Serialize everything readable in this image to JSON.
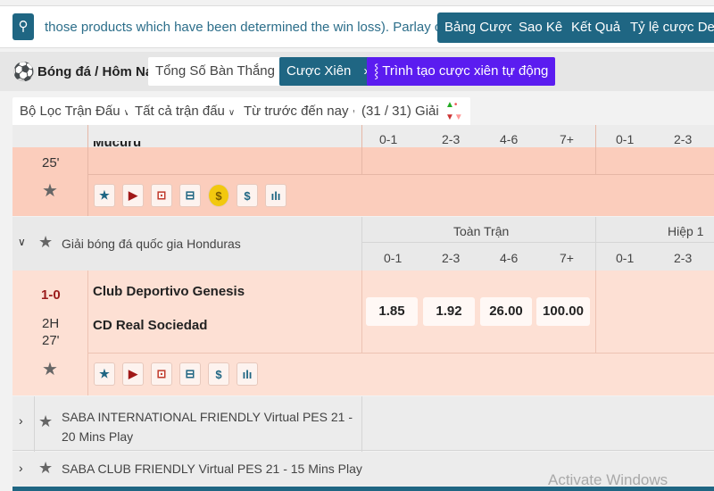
{
  "topbar": {
    "search_icon": "search-icon",
    "marquee": "those products which have been determined the win loss). Parlay counted",
    "buttons": [
      "Bảng Cược",
      "Sao Kê",
      "Kết Quả",
      "Tỷ lệ cược Decim"
    ]
  },
  "toolbar": {
    "sport_icon": "soccer-ball-icon",
    "breadcrumb": "Bóng đá / Hôm Nay",
    "market": "Tổng Số Bàn Thắng",
    "parlay": "Cược Xiên",
    "auto_parlay": "Trình tạo cược xiên tự động"
  },
  "filters": {
    "match_filter": "Bộ Lọc Trận Đấu",
    "all_matches": "Tất cả trận đấu",
    "time_range": "Từ trước đến nay",
    "league_count": "(31 / 31) Giải"
  },
  "columns": {
    "full": "Toàn Trận",
    "half": "Hiệp 1",
    "goal_ranges": [
      "0-1",
      "2-3",
      "4-6",
      "7+"
    ],
    "half_ranges": [
      "0-1",
      "2-3"
    ]
  },
  "match_prev": {
    "team": "Mucuru",
    "time": "25'"
  },
  "league": {
    "name": "Giải bóng đá quốc gia Honduras"
  },
  "match": {
    "score": "1-0",
    "period": "2H",
    "minute": "27'",
    "home": "Club Deportivo Genesis",
    "away": "CD Real Sociedad",
    "odds": [
      "1.85",
      "1.92",
      "26.00",
      "100.00"
    ]
  },
  "leagues_collapsed": [
    {
      "name": "SABA INTERNATIONAL FRIENDLY Virtual PES 21 - 20 Mins Play"
    },
    {
      "name": "SABA CLUB FRIENDLY Virtual PES 21 - 15 Mins Play"
    }
  ],
  "watermark": "Activate Windows",
  "colors": {
    "primary": "#1f6683",
    "purple": "#5b1cf0",
    "live_row": "#fbcdbc",
    "match_row": "#fde0d4"
  }
}
